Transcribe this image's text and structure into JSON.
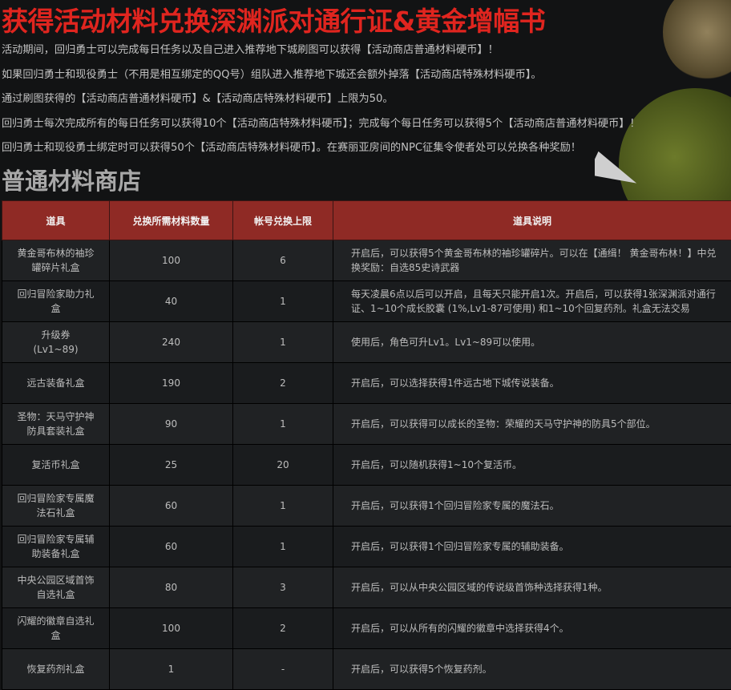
{
  "header": {
    "title": "获得活动材料兑换深渊派对通行证&黄金增幅书"
  },
  "description": [
    "活动期间，回归勇士可以完成每日任务以及自己进入推荐地下城刷图可以获得【活动商店普通材料硬币】！",
    "如果回归勇士和现役勇士（不用是相互绑定的QQ号）组队进入推荐地下城还会额外掉落【活动商店特殊材料硬币】。",
    "通过刷图获得的【活动商店普通材料硬币】&【活动商店特殊材料硬币】上限为50。",
    "回归勇士每次完成所有的每日任务可以获得10个【活动商店特殊材料硬币】；完成每个每日任务可以获得5个【活动商店普通材料硬币】！",
    "回归勇士和现役勇士绑定时可以获得50个【活动商店特殊材料硬币】。在赛丽亚房间的NPC征集令使者处可以兑换各种奖励！"
  ],
  "shop": {
    "title": "普通材料商店",
    "columns": [
      "道具",
      "兑换所需材料数量",
      "帐号兑换上限",
      "道具说明"
    ],
    "rows": [
      {
        "name": "黄金哥布林的袖珍罐碎片礼盒",
        "cost": "100",
        "limit": "6",
        "desc": "开启后，可以获得5个黄金哥布林的袖珍罐碎片。可以在【通缉！ 黄金哥布林！】中兑换奖励：自选85史诗武器"
      },
      {
        "name": "回归冒险家助力礼盒",
        "cost": "40",
        "limit": "1",
        "desc": "每天凌晨6点以后可以开启，且每天只能开启1次。开启后，可以获得1张深渊派对通行证、1~10个成长胶囊 (1%,Lv1-87可使用) 和1~10个回复药剂。礼盒无法交易"
      },
      {
        "name": "升级券\n(Lv1~89)",
        "cost": "240",
        "limit": "1",
        "desc": "使用后，角色可升Lv1。Lv1~89可以使用。"
      },
      {
        "name": "远古装备礼盒",
        "cost": "190",
        "limit": "2",
        "desc": "开启后，可以选择获得1件远古地下城传说装备。"
      },
      {
        "name": "圣物：天马守护神防具套装礼盒",
        "cost": "90",
        "limit": "1",
        "desc": "开启后，可以获得可以成长的圣物：荣耀的天马守护神的防具5个部位。"
      },
      {
        "name": "复活币礼盒",
        "cost": "25",
        "limit": "20",
        "desc": "开启后，可以随机获得1~10个复活币。"
      },
      {
        "name": "回归冒险家专属魔法石礼盒",
        "cost": "60",
        "limit": "1",
        "desc": "开启后，可以获得1个回归冒险家专属的魔法石。"
      },
      {
        "name": "回归冒险家专属辅助装备礼盒",
        "cost": "60",
        "limit": "1",
        "desc": "开启后，可以获得1个回归冒险家专属的辅助装备。"
      },
      {
        "name": "中央公园区域首饰自选礼盒",
        "cost": "80",
        "limit": "3",
        "desc": "开启后，可以从中央公园区域的传说级首饰种选择获得1种。"
      },
      {
        "name": "闪耀的徽章自选礼盒",
        "cost": "100",
        "limit": "2",
        "desc": "开启后，可以从所有的闪耀的徽章中选择获得4个。"
      },
      {
        "name": "恢复药剂礼盒",
        "cost": "1",
        "limit": "-",
        "desc": "开启后，可以获得5个恢复药剂。"
      }
    ]
  },
  "colors": {
    "title": "#e0251f",
    "header_bg": "#8f2a25",
    "background": "#121314"
  }
}
